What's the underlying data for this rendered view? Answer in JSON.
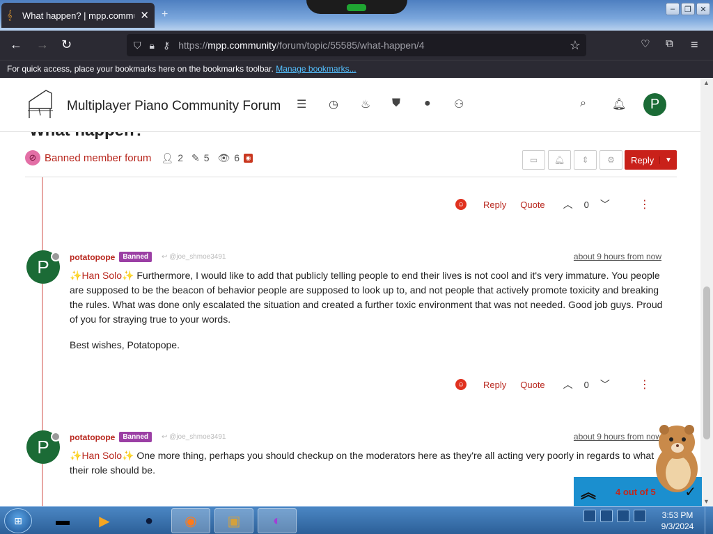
{
  "browser": {
    "tab_title": "What happen? | mpp.commun",
    "url_prefix": "https://",
    "url_domain": "mpp.community",
    "url_path": "/forum/topic/55585/what-happen/4",
    "bookmarks_text": "For quick access, place your bookmarks here on the bookmarks toolbar.",
    "bookmarks_link": "Manage bookmarks..."
  },
  "forum": {
    "site_title": "Multiplayer Piano Community Forum",
    "user_initial": "P"
  },
  "topic": {
    "title": "What happen?",
    "category": "Banned member forum",
    "posters": "2",
    "posts": "5",
    "views": "6",
    "reply_label": "Reply"
  },
  "actions": {
    "reply": "Reply",
    "quote": "Quote"
  },
  "prev_post": {
    "votes": "0"
  },
  "posts": [
    {
      "initial": "P",
      "username": "potatopope",
      "badge": "Banned",
      "reply_to": "@joe_shmoe3491",
      "time": "about 9 hours from now",
      "mention": "Han Solo",
      "text1": "Furthermore, I would like to add that publicly telling people to end their lives is not cool and it's very immature. You people are supposed to be the beacon of behavior people are supposed to look up to, and not people that actively promote toxicity and breaking the rules. What was done only escalated the situation and created a further toxic environment that was not needed. Good job guys. Proud of you for straying true to your words.",
      "text2": "Best wishes, Potatopope.",
      "votes": "0"
    },
    {
      "initial": "P",
      "username": "potatopope",
      "badge": "Banned",
      "reply_to": "@joe_shmoe3491",
      "time": "about 9 hours from now",
      "mention": "Han Solo",
      "text1": "One more thing, perhaps you should checkup on the moderators here as they're all acting very poorly in regards to what their role should be."
    }
  ],
  "progress": {
    "label": "4 out of 5",
    "current": 4,
    "total": 5
  },
  "taskbar": {
    "time": "3:53 PM",
    "date": "9/3/2024"
  },
  "colors": {
    "accent": "#b8261d",
    "reply_button": "#c9211a",
    "banned_badge": "#9b3fa4",
    "avatar": "#1b6b36",
    "category_badge": "#e36fa6"
  }
}
